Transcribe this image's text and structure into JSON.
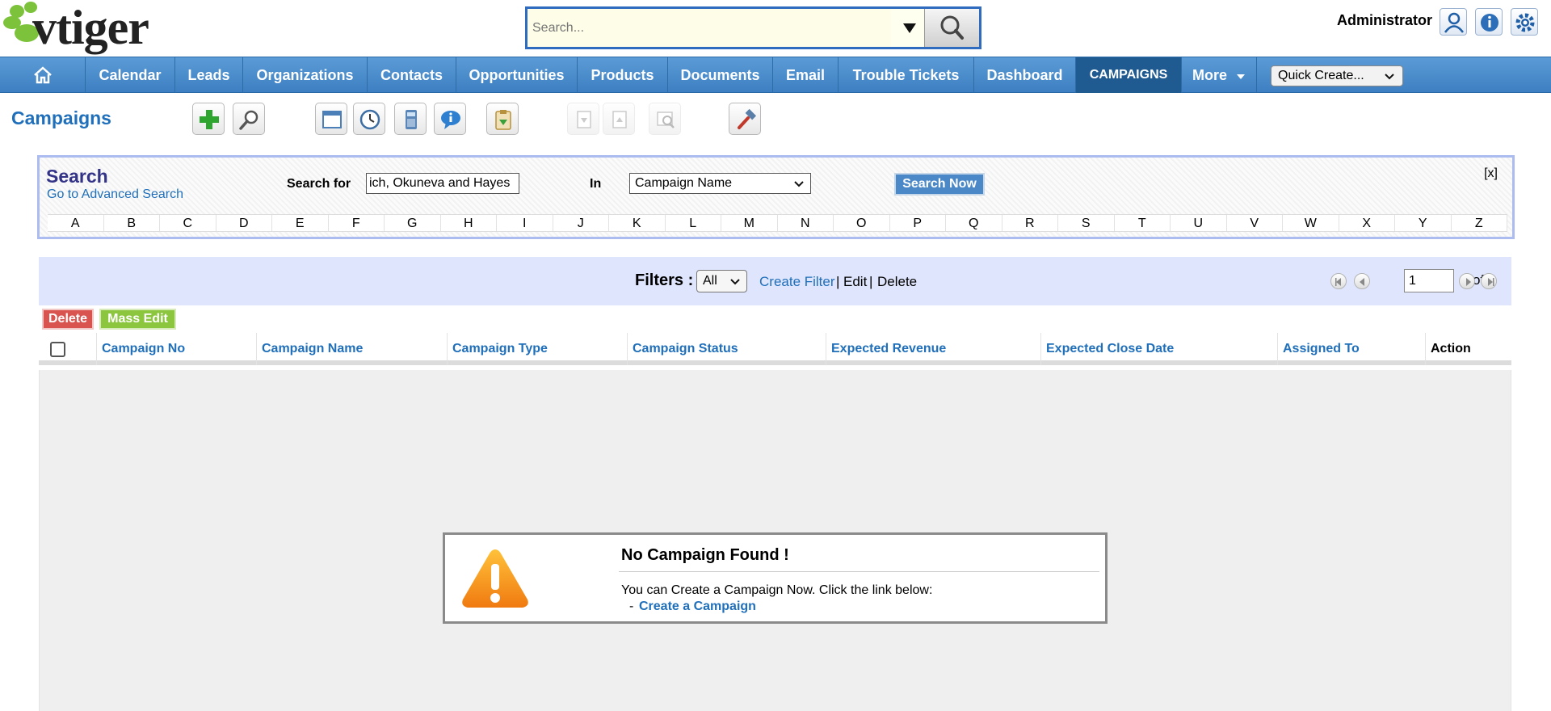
{
  "header": {
    "logo_text": "vtiger",
    "search_placeholder": "Search...",
    "user_label": "Administrator"
  },
  "nav": {
    "items": [
      {
        "label": "Calendar"
      },
      {
        "label": "Leads"
      },
      {
        "label": "Organizations"
      },
      {
        "label": "Contacts"
      },
      {
        "label": "Opportunities"
      },
      {
        "label": "Products"
      },
      {
        "label": "Documents"
      },
      {
        "label": "Email"
      },
      {
        "label": "Trouble Tickets"
      },
      {
        "label": "Dashboard"
      },
      {
        "label": "CAMPAIGNS",
        "active": true
      },
      {
        "label": "More"
      }
    ],
    "quick_create": "Quick Create..."
  },
  "module": {
    "title": "Campaigns"
  },
  "search": {
    "title": "Search",
    "advanced_link": "Go to Advanced Search",
    "search_for_label": "Search for",
    "search_value": "ich, Okuneva and Hayes",
    "in_label": "In",
    "field_selected": "Campaign Name",
    "search_button": "Search Now",
    "close": "[x]",
    "alphabet": [
      "A",
      "B",
      "C",
      "D",
      "E",
      "F",
      "G",
      "H",
      "I",
      "J",
      "K",
      "L",
      "M",
      "N",
      "O",
      "P",
      "Q",
      "R",
      "S",
      "T",
      "U",
      "V",
      "W",
      "X",
      "Y",
      "Z"
    ]
  },
  "filters": {
    "label": "Filters :",
    "selected": "All",
    "create_filter": "Create Filter",
    "sep1": "|",
    "edit": "Edit",
    "sep2": "|",
    "delete": "Delete",
    "page_value": "1",
    "page_of": "of 1"
  },
  "actions": {
    "delete": "Delete",
    "mass_edit": "Mass Edit"
  },
  "table": {
    "columns": [
      "Campaign No",
      "Campaign Name",
      "Campaign Type",
      "Campaign Status",
      "Expected Revenue",
      "Expected Close Date",
      "Assigned To",
      "Action"
    ]
  },
  "empty": {
    "title": "No Campaign Found !",
    "text": "You can Create a Campaign Now. Click the link below:",
    "link_prefix": "-",
    "link": "Create a Campaign"
  },
  "colors": {
    "nav": "#4a8cd0",
    "nav_active": "#1f5a91",
    "link": "#1f6fba",
    "delete": "#d9534f",
    "mass_edit": "#8cc63f",
    "filter_bar": "#dfe5fc"
  }
}
